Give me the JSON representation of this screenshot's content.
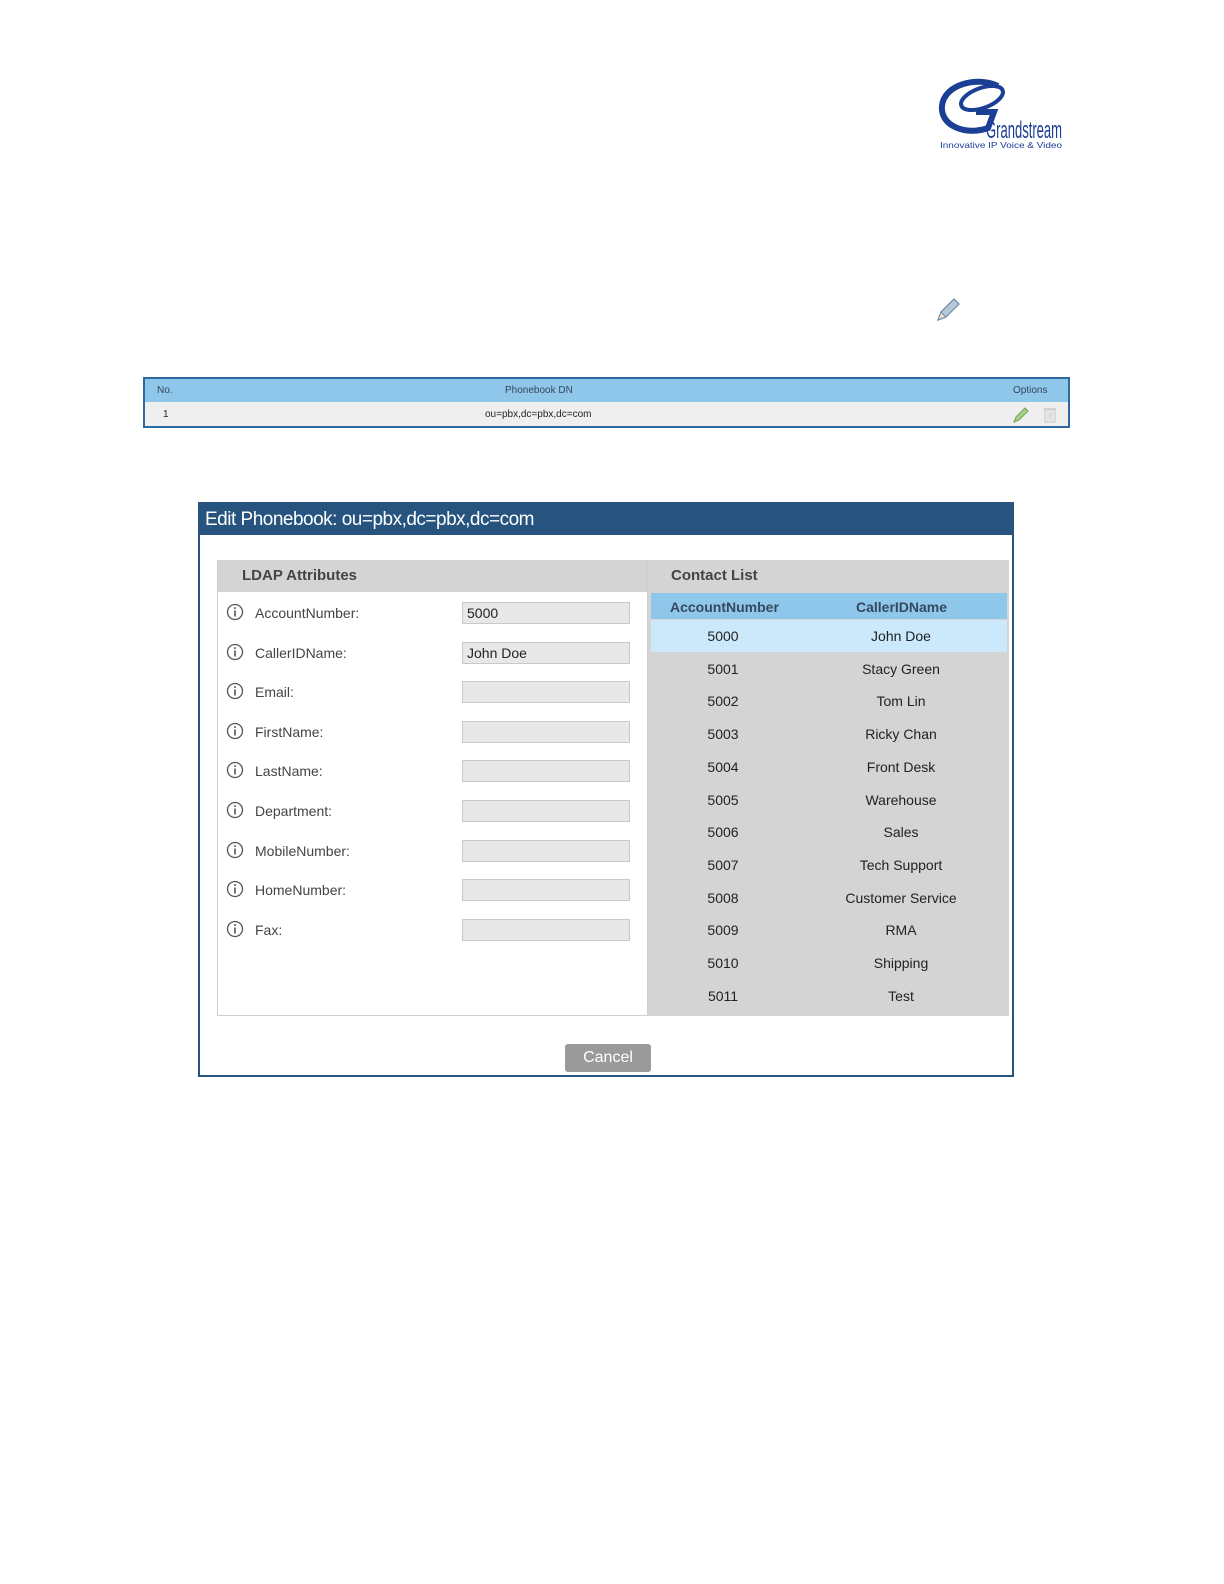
{
  "logo": {
    "brand_text": "Grandstream",
    "tagline": "Innovative IP Voice & Video",
    "color": "#1b3f95"
  },
  "phonebook_table": {
    "headers": {
      "no": "No.",
      "dn": "Phonebook DN",
      "options": "Options"
    },
    "rows": [
      {
        "no": "1",
        "dn": "ou=pbx,dc=pbx,dc=com"
      }
    ]
  },
  "dialog": {
    "title": "Edit Phonebook: ou=pbx,dc=pbx,dc=com",
    "ldap_panel_title": "LDAP Attributes",
    "attributes": [
      {
        "label": "AccountNumber:",
        "value": "5000"
      },
      {
        "label": "CallerIDName:",
        "value": "John Doe"
      },
      {
        "label": "Email:",
        "value": ""
      },
      {
        "label": "FirstName:",
        "value": ""
      },
      {
        "label": "LastName:",
        "value": ""
      },
      {
        "label": "Department:",
        "value": ""
      },
      {
        "label": "MobileNumber:",
        "value": ""
      },
      {
        "label": "HomeNumber:",
        "value": ""
      },
      {
        "label": "Fax:",
        "value": ""
      }
    ],
    "contact_panel_title": "Contact List",
    "contact_headers": {
      "account": "AccountNumber",
      "name": "CallerIDName"
    },
    "contacts": [
      {
        "account": "5000",
        "name": "John Doe"
      },
      {
        "account": "5001",
        "name": "Stacy Green"
      },
      {
        "account": "5002",
        "name": "Tom Lin"
      },
      {
        "account": "5003",
        "name": "Ricky Chan"
      },
      {
        "account": "5004",
        "name": "Front Desk"
      },
      {
        "account": "5005",
        "name": "Warehouse"
      },
      {
        "account": "5006",
        "name": "Sales"
      },
      {
        "account": "5007",
        "name": "Tech Support"
      },
      {
        "account": "5008",
        "name": "Customer Service"
      },
      {
        "account": "5009",
        "name": "RMA"
      },
      {
        "account": "5010",
        "name": "Shipping"
      },
      {
        "account": "5011",
        "name": "Test"
      }
    ],
    "selected_contact": "5000",
    "cancel_label": "Cancel"
  },
  "colors": {
    "header_blue": "#26547f",
    "table_head": "#8fc7ea",
    "selected_row": "#cbe9fa"
  }
}
